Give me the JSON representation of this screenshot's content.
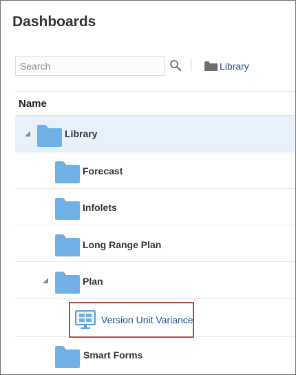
{
  "page": {
    "title": "Dashboards"
  },
  "search": {
    "placeholder": "Search",
    "value": ""
  },
  "breadcrumb": {
    "label": "Library"
  },
  "table": {
    "column_name": "Name"
  },
  "tree": {
    "library": "Library",
    "forecast": "Forecast",
    "infolets": "Infolets",
    "long_range_plan": "Long Range Plan",
    "plan": "Plan",
    "version_unit_variance": "Version Unit Variance",
    "smart_forms": "Smart Forms"
  },
  "colors": {
    "folder": "#6fb0e6",
    "selected_row": "#e6f1fb",
    "link": "#1f4e8c",
    "highlight_border": "#b34b44"
  }
}
